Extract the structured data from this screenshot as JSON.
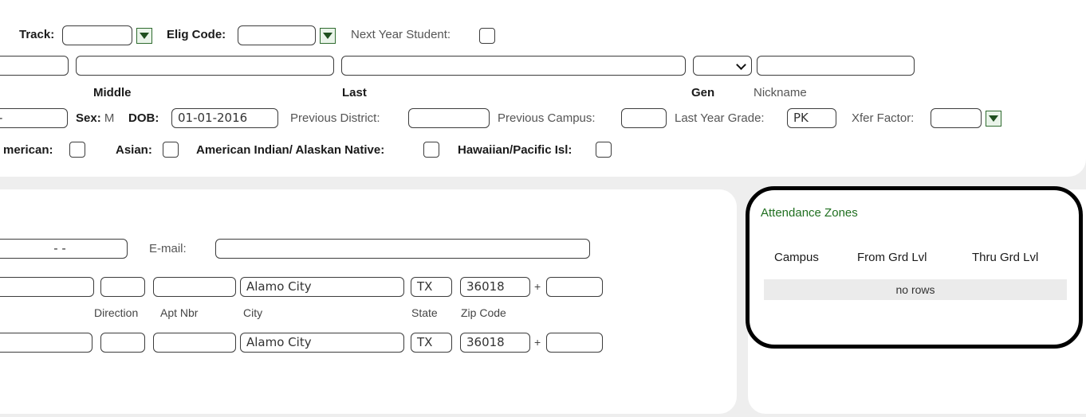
{
  "top": {
    "track_label": "Track:",
    "track_value": "",
    "elig_label": "Elig Code:",
    "elig_value": "",
    "next_year_label": "Next Year Student:",
    "name_captions": {
      "middle": "Middle",
      "last": "Last",
      "gen": "Gen",
      "nickname": "Nickname"
    },
    "field_left_value": "-",
    "sex_label": "Sex:",
    "sex_value": "M",
    "dob_label": "DOB:",
    "dob_value": "01-01-2016",
    "prev_district_label": "Previous District:",
    "prev_campus_label": "Previous Campus:",
    "last_year_grade_label": "Last Year Grade:",
    "last_year_grade_value": "PK",
    "xfer_factor_label": "Xfer Factor:",
    "race": {
      "american_label": "merican:",
      "asian_label": "Asian:",
      "american_indian_label": "American Indian/ Alaskan Native:",
      "hawaiian_label": "Hawaiian/Pacific Isl:"
    }
  },
  "address": {
    "phone_value": "-  -",
    "email_label": "E-mail:",
    "row1": {
      "city": "Alamo City",
      "state": "TX",
      "zip": "36018",
      "plus": "+"
    },
    "captions": {
      "direction": "Direction",
      "apt_nbr": "Apt Nbr",
      "city": "City",
      "state": "State",
      "zip_code": "Zip Code"
    },
    "row2": {
      "city": "Alamo City",
      "state": "TX",
      "zip": "36018",
      "plus": "+"
    }
  },
  "attendance_zones": {
    "title": "Attendance Zones",
    "columns": [
      "Campus",
      "From Grd Lvl",
      "Thru Grd Lvl"
    ],
    "empty_text": "no rows"
  },
  "colors": {
    "accent_green": "#1f6f1f",
    "highlight_border": "#000000"
  }
}
